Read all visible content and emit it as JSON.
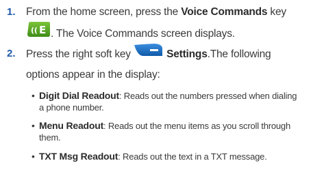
{
  "steps": [
    {
      "number": "1.",
      "text_a": "From the home screen, press the ",
      "bold_a": "Voice Commands",
      "text_b": " key",
      "text_c": ". The Voice Commands screen displays.",
      "icon": "voice-commands-key-icon",
      "icon_color": "#58a826"
    },
    {
      "number": "2.",
      "text_a": "Press the right soft key ",
      "bold_a": "Settings",
      "text_b": ".The following",
      "text_c": "options appear in the display:",
      "icon": "right-soft-key-icon",
      "icon_color": "#1a6fbf"
    }
  ],
  "options": [
    {
      "title": "Digit Dial Readout",
      "desc_line1": ": Reads out the numbers pressed when dialing",
      "desc_line2": "a phone number."
    },
    {
      "title": "Menu Readout",
      "desc_line1": ": Reads out the menu items as you scroll through",
      "desc_line2": "them."
    },
    {
      "title": "TXT Msg Readout",
      "desc_line1": ": Reads out the text in a TXT message.",
      "desc_line2": ""
    }
  ],
  "bullet_char": "•"
}
